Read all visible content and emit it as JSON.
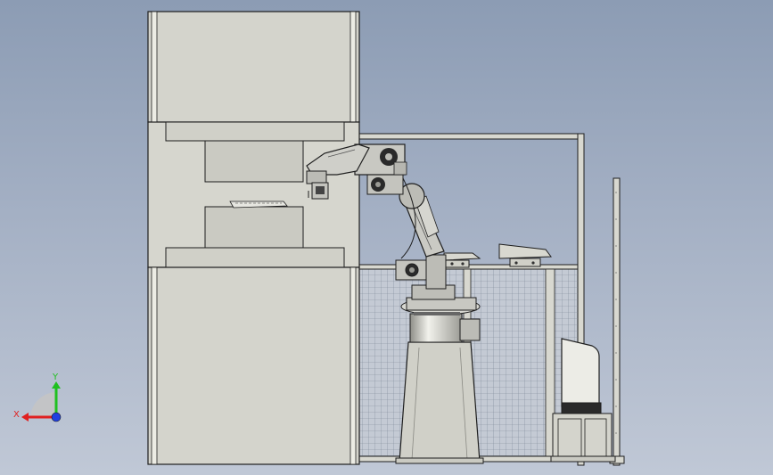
{
  "viewport": {
    "background_top": "#8c9cb4",
    "background_bottom": "#c0c8d6"
  },
  "triad": {
    "x_label": "X",
    "y_label": "Y",
    "x_color": "#e02020",
    "y_color": "#20c020",
    "z_color": "#2040e0"
  },
  "colors": {
    "machine_fill": "#d4d4cc",
    "line": "#1e1e1e",
    "robot": "#c8c8c2",
    "fence_mesh": "#b8c0cc"
  }
}
